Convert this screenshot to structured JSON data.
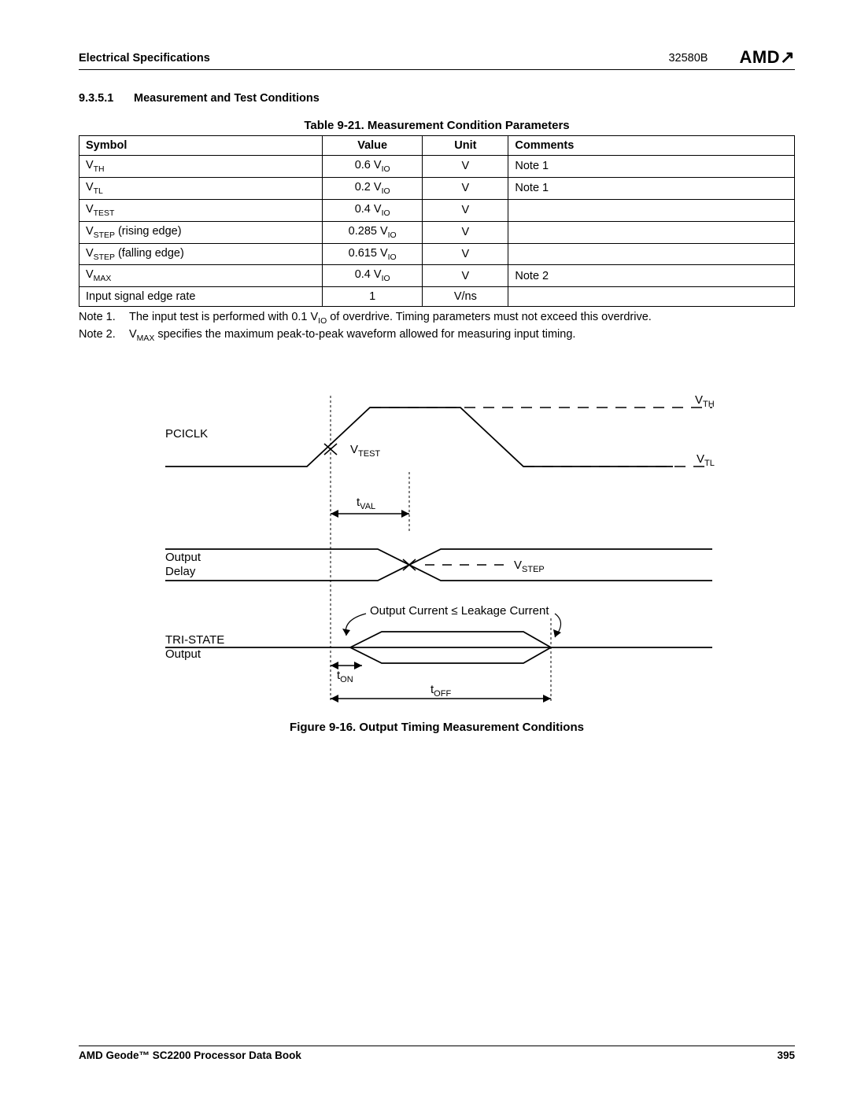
{
  "header": {
    "section": "Electrical Specifications",
    "docnum": "32580B",
    "logo": "AMD"
  },
  "section": {
    "num": "9.3.5.1",
    "title": "Measurement and Test Conditions"
  },
  "table": {
    "title": "Table 9-21.  Measurement Condition Parameters",
    "headers": [
      "Symbol",
      "Value",
      "Unit",
      "Comments"
    ],
    "rows": [
      {
        "sym": "V",
        "sub": "TH",
        "suffix": "",
        "val": "0.6 V",
        "vsub": "IO",
        "unit": "V",
        "comment": "Note 1"
      },
      {
        "sym": "V",
        "sub": "TL",
        "suffix": "",
        "val": "0.2 V",
        "vsub": "IO",
        "unit": "V",
        "comment": "Note 1"
      },
      {
        "sym": "V",
        "sub": "TEST",
        "suffix": "",
        "val": "0.4 V",
        "vsub": "IO",
        "unit": "V",
        "comment": ""
      },
      {
        "sym": "V",
        "sub": "STEP",
        "suffix": " (rising edge)",
        "val": "0.285 V",
        "vsub": "IO",
        "unit": "V",
        "comment": ""
      },
      {
        "sym": "V",
        "sub": "STEP",
        "suffix": " (falling edge)",
        "val": "0.615 V",
        "vsub": "IO",
        "unit": "V",
        "comment": ""
      },
      {
        "sym": "V",
        "sub": "MAX",
        "suffix": "",
        "val": "0.4 V",
        "vsub": "IO",
        "unit": "V",
        "comment": "Note 2"
      },
      {
        "sym": "Input signal edge rate",
        "sub": "",
        "suffix": "",
        "val": "1",
        "vsub": "",
        "unit": "V/ns",
        "comment": ""
      }
    ]
  },
  "notes": {
    "n1": {
      "label": "Note 1.",
      "text_a": "The input test is performed with 0.1 V",
      "sub": "IO",
      "text_b": " of overdrive. Timing parameters must not exceed this overdrive."
    },
    "n2": {
      "label": "Note 2.",
      "text_a": "V",
      "sub": "MAX",
      "text_b": " specifies the maximum peak-to-peak waveform allowed for measuring input timing."
    }
  },
  "figure": {
    "title": "Figure 9-16.  Output Timing Measurement Conditions",
    "labels": {
      "pciclk": "PCICLK",
      "vth": "V",
      "vth_sub": "TH",
      "vtl": "V",
      "vtl_sub": "TL",
      "vtest": "V",
      "vtest_sub": "TEST",
      "tval": "t",
      "tval_sub": "VAL",
      "outdelay1": "Output",
      "outdelay2": "Delay",
      "vstep": "V",
      "vstep_sub": "STEP",
      "leakage": "Output Current  ≤ Leakage Current",
      "tristate1": "TRI-STATE",
      "tristate2": "Output",
      "ton": "t",
      "ton_sub": "ON",
      "toff": "t",
      "toff_sub": "OFF"
    }
  },
  "footer": {
    "left": "AMD Geode™ SC2200  Processor Data Book",
    "right": "395"
  }
}
